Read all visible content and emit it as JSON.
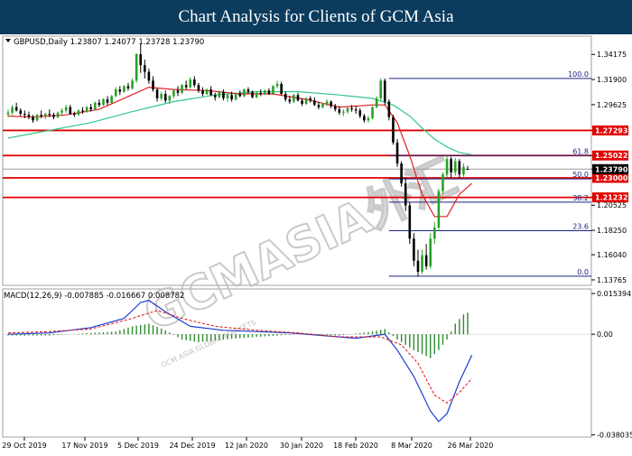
{
  "banner": {
    "title": "Chart Analysis for Clients of GCM Asia"
  },
  "watermark": {
    "text": "GCMASIA外汇",
    "sub": "GCM ASIA GLOBAL MARKETS",
    "color": "#b9b9b9"
  },
  "colors": {
    "bull": "#28a028",
    "bear": "#000000",
    "ma_fast": "#e02020",
    "ma_slow": "#34c88a",
    "level": "#e00000",
    "fib": "#1a237e",
    "current": "#000000",
    "macd": "#1e3cd2",
    "signal": "#e02020",
    "hist": "#2e8b2e",
    "grid_line": "#a0a0a0"
  },
  "chart_data": [
    {
      "type": "candlestick",
      "header": "GBPUSD,Daily  1.23807 1.24077 1.23728 1.23790",
      "symbol": "GBPUSD",
      "timeframe": "Daily",
      "ohlc_readout": {
        "open": 1.23807,
        "high": 1.24077,
        "low": 1.23728,
        "close": 1.2379
      },
      "ylim": [
        1.1327,
        1.3583
      ],
      "y_ticks": [
        "1.34175",
        "1.31900",
        "1.29625",
        "1.27293",
        "1.25022",
        "1.23790",
        "1.23000",
        "1.21232",
        "1.20525",
        "1.18250",
        "1.16040",
        "1.13765"
      ],
      "x_ticks": [
        "29 Oct 2019",
        "17 Nov 2019",
        "5 Dec 2019",
        "24 Dec 2019",
        "12 Jan 2020",
        "30 Jan 2020",
        "18 Feb 2020",
        "8 Mar 2020",
        "26 Mar 2020"
      ],
      "current_price": 1.2379,
      "current_label": "1.23790",
      "levels": [
        {
          "price": 1.27293,
          "label": "1.27293"
        },
        {
          "price": 1.25022,
          "label": "1.25022"
        },
        {
          "price": 1.23,
          "label": "1.23000"
        },
        {
          "price": 1.21232,
          "label": "1.21232"
        }
      ],
      "fibonacci": [
        {
          "ratio": "100.0",
          "price": 1.32
        },
        {
          "ratio": "61.8",
          "price": 1.2502
        },
        {
          "ratio": "50.0",
          "price": 1.229
        },
        {
          "ratio": "38.2",
          "price": 1.208
        },
        {
          "ratio": "23.6",
          "price": 1.1822
        },
        {
          "ratio": "0.0",
          "price": 1.141
        }
      ],
      "candles": [
        [
          1.2875,
          1.292,
          1.285,
          1.289
        ],
        [
          1.289,
          1.296,
          1.287,
          1.294
        ],
        [
          1.294,
          1.298,
          1.29,
          1.291
        ],
        [
          1.291,
          1.293,
          1.286,
          1.288
        ],
        [
          1.288,
          1.291,
          1.284,
          1.287
        ],
        [
          1.287,
          1.29,
          1.283,
          1.285
        ],
        [
          1.285,
          1.287,
          1.28,
          1.282
        ],
        [
          1.282,
          1.288,
          1.281,
          1.287
        ],
        [
          1.287,
          1.291,
          1.284,
          1.286
        ],
        [
          1.286,
          1.289,
          1.283,
          1.288
        ],
        [
          1.288,
          1.292,
          1.285,
          1.287
        ],
        [
          1.287,
          1.289,
          1.283,
          1.285
        ],
        [
          1.285,
          1.29,
          1.284,
          1.289
        ],
        [
          1.289,
          1.293,
          1.286,
          1.291
        ],
        [
          1.291,
          1.296,
          1.289,
          1.294
        ],
        [
          1.294,
          1.296,
          1.287,
          1.288
        ],
        [
          1.288,
          1.29,
          1.285,
          1.287
        ],
        [
          1.287,
          1.292,
          1.286,
          1.291
        ],
        [
          1.291,
          1.294,
          1.288,
          1.29
        ],
        [
          1.29,
          1.295,
          1.289,
          1.294
        ],
        [
          1.294,
          1.297,
          1.29,
          1.292
        ],
        [
          1.292,
          1.299,
          1.291,
          1.298
        ],
        [
          1.298,
          1.301,
          1.294,
          1.296
        ],
        [
          1.296,
          1.302,
          1.295,
          1.301
        ],
        [
          1.301,
          1.304,
          1.296,
          1.298
        ],
        [
          1.298,
          1.305,
          1.297,
          1.304
        ],
        [
          1.304,
          1.312,
          1.303,
          1.31
        ],
        [
          1.31,
          1.313,
          1.305,
          1.308
        ],
        [
          1.308,
          1.314,
          1.307,
          1.313
        ],
        [
          1.313,
          1.316,
          1.309,
          1.311
        ],
        [
          1.311,
          1.32,
          1.31,
          1.318
        ],
        [
          1.318,
          1.343,
          1.316,
          1.342
        ],
        [
          1.342,
          1.351,
          1.325,
          1.332
        ],
        [
          1.332,
          1.337,
          1.32,
          1.326
        ],
        [
          1.326,
          1.329,
          1.315,
          1.318
        ],
        [
          1.318,
          1.322,
          1.308,
          1.31
        ],
        [
          1.31,
          1.311,
          1.299,
          1.302
        ],
        [
          1.302,
          1.308,
          1.3,
          1.306
        ],
        [
          1.306,
          1.309,
          1.298,
          1.3
        ],
        [
          1.3,
          1.305,
          1.297,
          1.304
        ],
        [
          1.304,
          1.31,
          1.302,
          1.309
        ],
        [
          1.309,
          1.313,
          1.304,
          1.307
        ],
        [
          1.307,
          1.315,
          1.306,
          1.314
        ],
        [
          1.314,
          1.318,
          1.31,
          1.312
        ],
        [
          1.312,
          1.321,
          1.311,
          1.319
        ],
        [
          1.319,
          1.322,
          1.312,
          1.314
        ],
        [
          1.314,
          1.316,
          1.307,
          1.309
        ],
        [
          1.309,
          1.312,
          1.304,
          1.306
        ],
        [
          1.306,
          1.311,
          1.305,
          1.31
        ],
        [
          1.31,
          1.313,
          1.304,
          1.305
        ],
        [
          1.305,
          1.307,
          1.3,
          1.303
        ],
        [
          1.303,
          1.309,
          1.302,
          1.308
        ],
        [
          1.308,
          1.31,
          1.3,
          1.302
        ],
        [
          1.302,
          1.306,
          1.299,
          1.305
        ],
        [
          1.305,
          1.308,
          1.299,
          1.301
        ],
        [
          1.301,
          1.307,
          1.3,
          1.306
        ],
        [
          1.306,
          1.309,
          1.303,
          1.304
        ],
        [
          1.304,
          1.311,
          1.303,
          1.31
        ],
        [
          1.31,
          1.312,
          1.306,
          1.308
        ],
        [
          1.308,
          1.309,
          1.302,
          1.303
        ],
        [
          1.303,
          1.308,
          1.302,
          1.307
        ],
        [
          1.307,
          1.31,
          1.304,
          1.306
        ],
        [
          1.306,
          1.31,
          1.305,
          1.309
        ],
        [
          1.309,
          1.311,
          1.305,
          1.306
        ],
        [
          1.306,
          1.314,
          1.305,
          1.313
        ],
        [
          1.313,
          1.318,
          1.311,
          1.315
        ],
        [
          1.315,
          1.317,
          1.305,
          1.306
        ],
        [
          1.306,
          1.308,
          1.299,
          1.301
        ],
        [
          1.301,
          1.304,
          1.297,
          1.299
        ],
        [
          1.299,
          1.306,
          1.298,
          1.305
        ],
        [
          1.305,
          1.307,
          1.299,
          1.3
        ],
        [
          1.3,
          1.302,
          1.295,
          1.297
        ],
        [
          1.297,
          1.303,
          1.296,
          1.302
        ],
        [
          1.302,
          1.304,
          1.298,
          1.3
        ],
        [
          1.3,
          1.303,
          1.295,
          1.296
        ],
        [
          1.296,
          1.299,
          1.292,
          1.294
        ],
        [
          1.294,
          1.298,
          1.293,
          1.297
        ],
        [
          1.297,
          1.301,
          1.295,
          1.299
        ],
        [
          1.299,
          1.3,
          1.293,
          1.295
        ],
        [
          1.295,
          1.297,
          1.29,
          1.292
        ],
        [
          1.292,
          1.295,
          1.287,
          1.289
        ],
        [
          1.289,
          1.292,
          1.286,
          1.29
        ],
        [
          1.29,
          1.294,
          1.288,
          1.293
        ],
        [
          1.293,
          1.296,
          1.29,
          1.292
        ],
        [
          1.292,
          1.295,
          1.288,
          1.291
        ],
        [
          1.291,
          1.293,
          1.284,
          1.286
        ],
        [
          1.286,
          1.288,
          1.28,
          1.282
        ],
        [
          1.282,
          1.286,
          1.28,
          1.284
        ],
        [
          1.284,
          1.295,
          1.283,
          1.294
        ],
        [
          1.294,
          1.304,
          1.293,
          1.302
        ],
        [
          1.302,
          1.32,
          1.3,
          1.318
        ],
        [
          1.318,
          1.32,
          1.296,
          1.299
        ],
        [
          1.299,
          1.301,
          1.282,
          1.285
        ],
        [
          1.285,
          1.287,
          1.26,
          1.262
        ],
        [
          1.262,
          1.265,
          1.24,
          1.243
        ],
        [
          1.243,
          1.245,
          1.222,
          1.225
        ],
        [
          1.225,
          1.23,
          1.2,
          1.205
        ],
        [
          1.205,
          1.208,
          1.17,
          1.175
        ],
        [
          1.175,
          1.18,
          1.15,
          1.155
        ],
        [
          1.155,
          1.165,
          1.141,
          1.145
        ],
        [
          1.145,
          1.165,
          1.143,
          1.16
        ],
        [
          1.16,
          1.17,
          1.147,
          1.15
        ],
        [
          1.15,
          1.18,
          1.148,
          1.175
        ],
        [
          1.175,
          1.19,
          1.17,
          1.185
        ],
        [
          1.185,
          1.22,
          1.183,
          1.218
        ],
        [
          1.218,
          1.235,
          1.215,
          1.233
        ],
        [
          1.233,
          1.25,
          1.23,
          1.247
        ],
        [
          1.247,
          1.249,
          1.23,
          1.235
        ],
        [
          1.235,
          1.248,
          1.232,
          1.245
        ],
        [
          1.245,
          1.247,
          1.23,
          1.233
        ],
        [
          1.233,
          1.243,
          1.231,
          1.24
        ],
        [
          1.238,
          1.2408,
          1.2373,
          1.2379
        ]
      ],
      "ma_fast": [
        [
          0,
          1.286
        ],
        [
          6,
          1.285
        ],
        [
          14,
          1.287
        ],
        [
          22,
          1.292
        ],
        [
          28,
          1.302
        ],
        [
          34,
          1.312
        ],
        [
          40,
          1.31
        ],
        [
          48,
          1.309
        ],
        [
          56,
          1.306
        ],
        [
          64,
          1.306
        ],
        [
          72,
          1.301
        ],
        [
          80,
          1.294
        ],
        [
          88,
          1.296
        ],
        [
          91,
          1.296
        ],
        [
          94,
          1.28
        ],
        [
          97,
          1.25
        ],
        [
          100,
          1.215
        ],
        [
          103,
          1.195
        ],
        [
          106,
          1.195
        ],
        [
          109,
          1.215
        ],
        [
          112,
          1.225
        ]
      ],
      "ma_slow": [
        [
          0,
          1.266
        ],
        [
          10,
          1.273
        ],
        [
          20,
          1.28
        ],
        [
          30,
          1.29
        ],
        [
          40,
          1.299
        ],
        [
          50,
          1.305
        ],
        [
          60,
          1.308
        ],
        [
          70,
          1.308
        ],
        [
          80,
          1.305
        ],
        [
          88,
          1.302
        ],
        [
          93,
          1.296
        ],
        [
          97,
          1.286
        ],
        [
          100,
          1.275
        ],
        [
          103,
          1.265
        ],
        [
          106,
          1.258
        ],
        [
          109,
          1.253
        ],
        [
          112,
          1.251
        ]
      ]
    },
    {
      "type": "macd",
      "header": "MACD(12,26,9) -0.007885 -0.016667 0.008782",
      "params": "12,26,9",
      "readout": {
        "macd": -0.007885,
        "signal": -0.016667,
        "histogram": 0.008782
      },
      "ylim": [
        -0.03885,
        0.01712
      ],
      "y_ticks": [
        "0.015394",
        "0.00",
        "-0.038035"
      ],
      "macd_line": [
        [
          0,
          0.0
        ],
        [
          10,
          0.0005
        ],
        [
          20,
          0.0025
        ],
        [
          28,
          0.006
        ],
        [
          32,
          0.012
        ],
        [
          34,
          0.0128
        ],
        [
          38,
          0.0085
        ],
        [
          44,
          0.003
        ],
        [
          52,
          0.0015
        ],
        [
          60,
          0.001
        ],
        [
          68,
          0.0005
        ],
        [
          76,
          -0.0005
        ],
        [
          84,
          -0.0015
        ],
        [
          91,
          0.0
        ],
        [
          94,
          -0.006
        ],
        [
          98,
          -0.016
        ],
        [
          102,
          -0.029
        ],
        [
          104,
          -0.033
        ],
        [
          106,
          -0.03
        ],
        [
          109,
          -0.018
        ],
        [
          112,
          -0.0079
        ]
      ],
      "signal_line": [
        [
          0,
          0.0005
        ],
        [
          10,
          0.001
        ],
        [
          20,
          0.002
        ],
        [
          30,
          0.006
        ],
        [
          36,
          0.009
        ],
        [
          42,
          0.006
        ],
        [
          50,
          0.003
        ],
        [
          60,
          0.0015
        ],
        [
          70,
          0.0005
        ],
        [
          80,
          -0.001
        ],
        [
          90,
          -0.001
        ],
        [
          95,
          -0.004
        ],
        [
          99,
          -0.011
        ],
        [
          103,
          -0.023
        ],
        [
          106,
          -0.026
        ],
        [
          109,
          -0.022
        ],
        [
          112,
          -0.0167
        ]
      ],
      "histogram_anchors": [
        [
          0,
          -0.0005
        ],
        [
          10,
          -0.0005
        ],
        [
          20,
          0.0005
        ],
        [
          26,
          0.001
        ],
        [
          30,
          0.003
        ],
        [
          34,
          0.004
        ],
        [
          38,
          0.0015
        ],
        [
          42,
          -0.002
        ],
        [
          46,
          -0.003
        ],
        [
          52,
          -0.002
        ],
        [
          60,
          -0.001
        ],
        [
          70,
          0.0
        ],
        [
          80,
          -0.0005
        ],
        [
          88,
          0.001
        ],
        [
          91,
          0.002
        ],
        [
          94,
          -0.002
        ],
        [
          98,
          -0.006
        ],
        [
          102,
          -0.009
        ],
        [
          104,
          -0.006
        ],
        [
          106,
          -0.002
        ],
        [
          108,
          0.004
        ],
        [
          110,
          0.0075
        ],
        [
          112,
          0.0088
        ]
      ]
    }
  ]
}
